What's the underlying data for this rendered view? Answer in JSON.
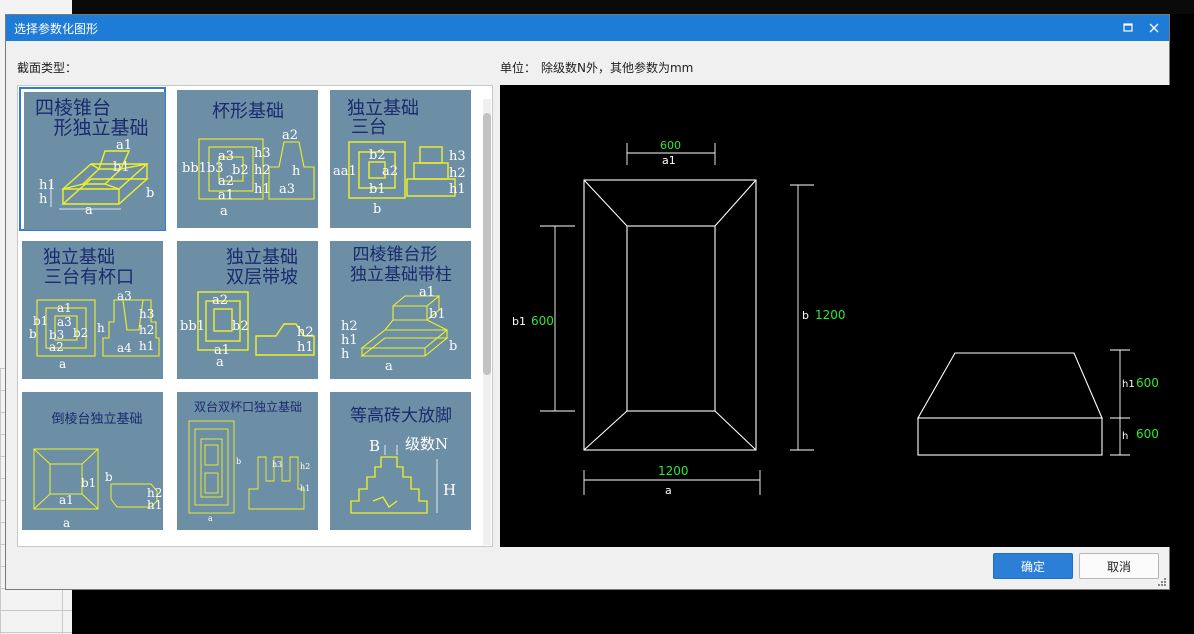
{
  "window": {
    "title": "选择参数化图形"
  },
  "labels": {
    "section_type": "截面类型：",
    "unit_label": "单位：",
    "unit_text": "除级数N外，其他参数为mm"
  },
  "tiles": [
    {
      "title1": "四棱锥台",
      "title2": "形独立基础",
      "a": "a",
      "a1": "a1",
      "b": "b",
      "b1": "b1",
      "h": "h",
      "h1": "h1"
    },
    {
      "title1": "杯形基础",
      "bb": "bb1b3",
      "b2": "b2",
      "a3": "a3",
      "h3": "h3",
      "h2": "h2",
      "h1": "h1",
      "a2": "a2",
      "a1": "a1",
      "a": "a",
      "h": "h"
    },
    {
      "title1": "独立基础",
      "title2": "三台",
      "aa1": "aa1",
      "b2": "b2",
      "a2": "a2",
      "b1": "b1",
      "b": "b",
      "h3": "h3",
      "h2": "h2",
      "h1": "h1"
    },
    {
      "title1": "独立基础",
      "title2": "三台有杯口",
      "a1": "a1",
      "a3": "a3",
      "b1": "b1",
      "b3": "b3",
      "b2": "b2",
      "a2": "a2",
      "a": "a",
      "h": "h",
      "a4": "a4",
      "h3": "h3",
      "h2": "h2",
      "h1": "h1",
      "bb": "b"
    },
    {
      "title1": "独立基础",
      "title2": "双层带坡",
      "a2": "a2",
      "bb1": "bb1",
      "b2": "b2",
      "a1": "a1",
      "a": "a",
      "h2": "h2",
      "h1": "h1"
    },
    {
      "title1": "四棱锥台形",
      "title2": "独立基础带柱",
      "a1": "a1",
      "b1": "b1",
      "h2": "h2",
      "h1": "h1",
      "h": "h",
      "b": "b",
      "a": "a"
    },
    {
      "title1": "倒棱台独立基础",
      "b1": "b1",
      "a1": "a1",
      "a": "a",
      "b": "b",
      "h2": "h2",
      "h1": "h1"
    },
    {
      "title1": "双台双杯口独立基础",
      "h1": "h1",
      "h2": "h2",
      "h3": "h3",
      "a": "a",
      "b": "b"
    },
    {
      "title1": "等高砖大放脚",
      "B": "B",
      "N": "级数N",
      "H": "H"
    }
  ],
  "preview": {
    "a1_value": "600",
    "a1_label": "a1",
    "b1_label": "b1",
    "b1_value": "600",
    "b_label": "b",
    "b_value": "1200",
    "a_value": "1200",
    "a_label": "a",
    "h1_label": "h1",
    "h1_value": "600",
    "h_label": "h",
    "h_value": "600"
  },
  "buttons": {
    "ok": "确定",
    "cancel": "取消"
  },
  "colors": {
    "titlebar": "#1e7bd6",
    "tile_bg": "#6d8fa6",
    "tile_title": "#1a2a6c",
    "drawing_line": "#f0f028",
    "dim_value": "#2ee82e"
  }
}
